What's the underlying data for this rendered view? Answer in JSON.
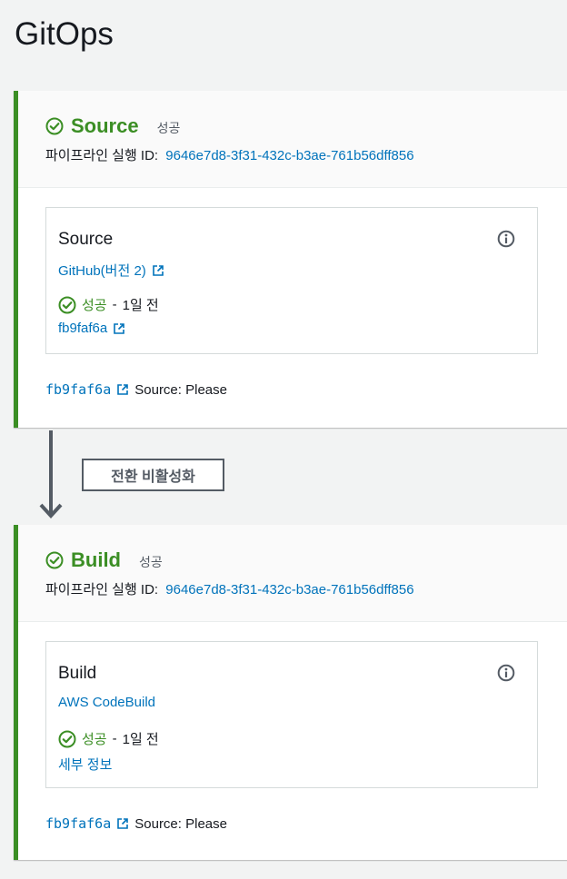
{
  "page": {
    "title": "GitOps"
  },
  "stages": [
    {
      "name": "Source",
      "status": "성공",
      "execution_label": "파이프라인 실행 ID:",
      "execution_id": "9646e7d8-3f31-432c-b3ae-761b56dff856",
      "action": {
        "name": "Source",
        "provider": "GitHub(버전 2)",
        "status_text": "성공",
        "separator": "-",
        "time": "1일 전",
        "detail_link": "fb9faf6a"
      },
      "commit": {
        "id": "fb9faf6a",
        "message": "Source: Please"
      }
    },
    {
      "name": "Build",
      "status": "성공",
      "execution_label": "파이프라인 실행 ID:",
      "execution_id": "9646e7d8-3f31-432c-b3ae-761b56dff856",
      "action": {
        "name": "Build",
        "provider": "AWS CodeBuild",
        "status_text": "성공",
        "separator": "-",
        "time": "1일 전",
        "detail_link": "세부 정보"
      },
      "commit": {
        "id": "fb9faf6a",
        "message": "Source: Please"
      }
    }
  ],
  "transition": {
    "label": "전환 비활성화"
  },
  "icons": {
    "check": "check-circle-icon",
    "info": "info-icon",
    "external_link": "external-link-icon",
    "arrow": "arrow-down-icon"
  },
  "colors": {
    "success": "#3b8e24",
    "link": "#0073bb",
    "text": "#16191f",
    "muted": "#545b64",
    "background": "#f2f3f3"
  }
}
